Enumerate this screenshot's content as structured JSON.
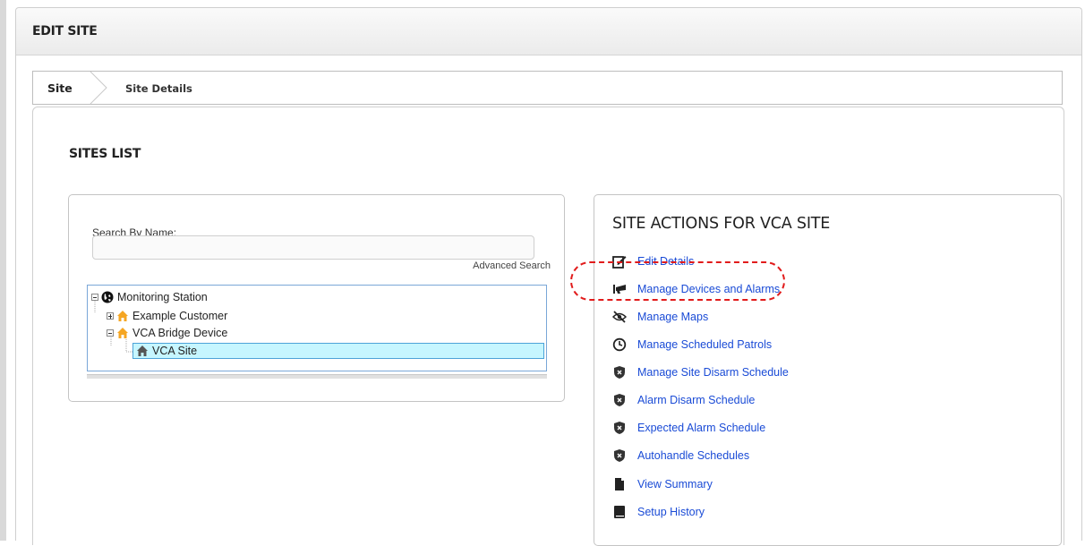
{
  "panel": {
    "title": "EDIT SITE"
  },
  "breadcrumb": {
    "items": [
      "Site",
      "Site Details"
    ]
  },
  "sites_list": {
    "title": "SITES LIST",
    "search_label": "Search By Name:",
    "search_value": "",
    "advanced_search": "Advanced Search",
    "tree": [
      {
        "label": "Monitoring Station",
        "icon": "globe-icon",
        "expander": "minus"
      },
      {
        "label": "Example Customer",
        "icon": "house-icon",
        "expander": "plus"
      },
      {
        "label": "VCA Bridge Device",
        "icon": "house-icon",
        "expander": "minus"
      },
      {
        "label": "VCA Site",
        "icon": "house-icon",
        "selected": true
      }
    ]
  },
  "actions": {
    "title": "SITE ACTIONS FOR VCA SITE",
    "items": [
      {
        "label": "Edit Details",
        "icon": "edit-icon"
      },
      {
        "label": "Manage Devices and Alarms",
        "icon": "camera-icon"
      },
      {
        "label": "Manage Maps",
        "icon": "map-hidden-icon"
      },
      {
        "label": "Manage Scheduled Patrols",
        "icon": "clock-icon"
      },
      {
        "label": "Manage Site Disarm Schedule",
        "icon": "shield-x-icon"
      },
      {
        "label": "Alarm Disarm Schedule",
        "icon": "shield-x-icon"
      },
      {
        "label": "Expected Alarm Schedule",
        "icon": "shield-x-icon"
      },
      {
        "label": "Autohandle Schedules",
        "icon": "shield-x-icon"
      },
      {
        "label": "View Summary",
        "icon": "document-icon"
      },
      {
        "label": "Setup History",
        "icon": "book-icon"
      }
    ]
  },
  "colors": {
    "link": "#1a4bd6",
    "selected_bg": "#c6f6ff",
    "highlight": "#e11b1b",
    "house": "#f5a623"
  }
}
